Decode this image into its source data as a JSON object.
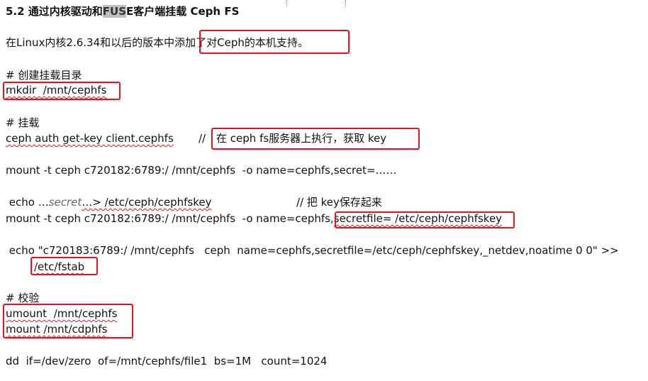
{
  "heading": {
    "pre": "5.2 通过内核驱动和",
    "highlight": "FUS",
    "post": "E客户端挂载 Ceph FS"
  },
  "intro": {
    "pre": "在Linux内核2.6.34和以后的版本中",
    "boxed": "添加了对Ceph的本机支持",
    "post": "。"
  },
  "section_mkdir": {
    "comment": "# 创建挂载目录",
    "command": "mkdir  /mnt/cephfs"
  },
  "section_mount": {
    "comment": "# 挂载",
    "cmd1": "ceph auth get-key client.cephfs",
    "cmd1_sep": "//",
    "cmd1_note": "在 ceph fs服务器上执行，获取 key",
    "cmd2": "mount -t ceph c720182:6789:/ /mnt/cephfs  -o name=cephfs,secret=……",
    "echo_pre": " echo …",
    "echo_secret": "secret",
    "echo_post": "…> /etc/ceph/cephfskey",
    "echo_note": "// 把 key保存起来",
    "cmd3_pre": "mount -t ceph c720182:6789:/ /mnt/cephfs  -o name=cephfs,",
    "cmd3_boxed": "secretfile= /etc/ceph/cephfskey",
    "fstab_line": " echo \"c720183:6789:/ /mnt/cephfs   ceph  name=cephfs,secretfile=/etc/ceph/cephfskey,_netdev,noatime 0 0\" >>",
    "fstab_target": "/etc/fstab"
  },
  "section_verify": {
    "comment": "# 校验",
    "umount": "umount  /mnt/cephfs",
    "mount": "mount /mnt/cdphfs",
    "dd": "dd  if=/dev/zero  of=/mnt/cephfs/file1  bs=1M   count=1024"
  },
  "colors": {
    "annotation_box": "#e3141c",
    "highlight": "#bfbfbf",
    "squiggle": "#d02020"
  }
}
